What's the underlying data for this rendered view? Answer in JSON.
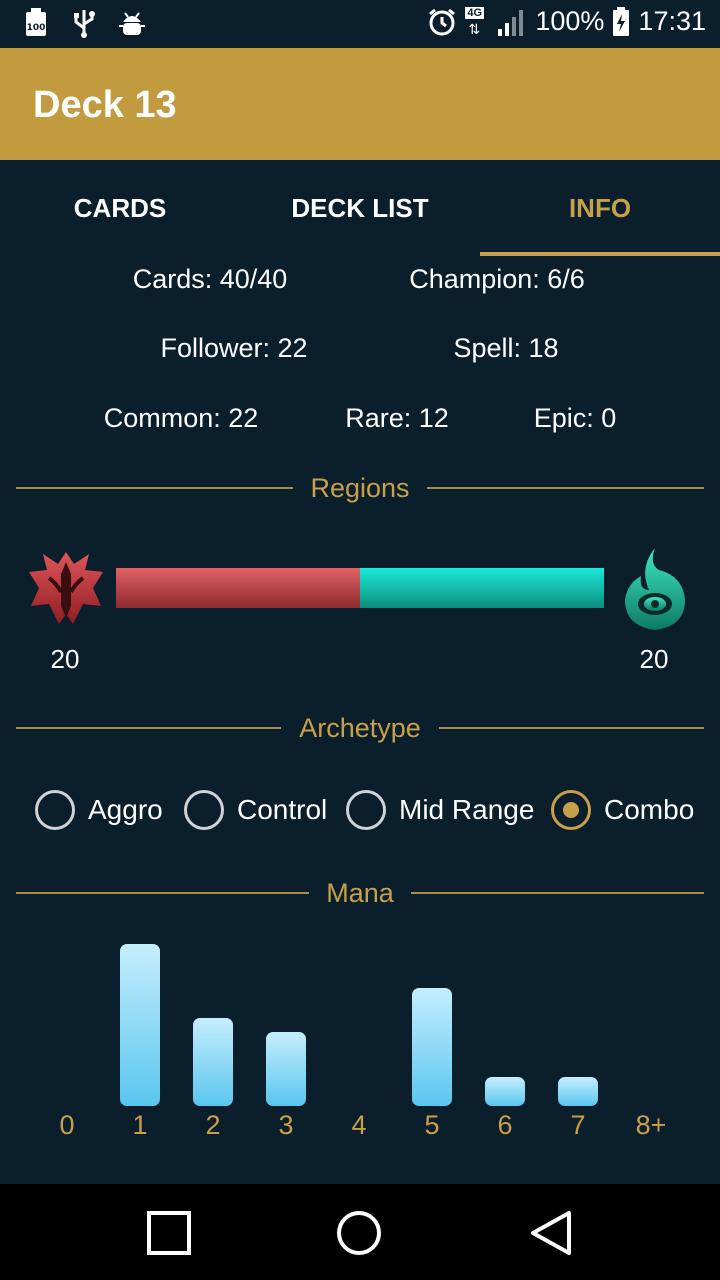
{
  "status_bar": {
    "left_icons": [
      "battery-100-icon",
      "usb-icon",
      "android-debug-icon"
    ],
    "network_badge": "4G",
    "battery": "100%",
    "time": "17:31"
  },
  "app_bar": {
    "title": "Deck 13"
  },
  "tabs": [
    {
      "label": "CARDS",
      "active": false
    },
    {
      "label": "DECK LIST",
      "active": false
    },
    {
      "label": "INFO",
      "active": true
    }
  ],
  "stats": {
    "cards": "Cards: 40/40",
    "champion": "Champion: 6/6",
    "follower": "Follower: 22",
    "spell": "Spell: 18",
    "common": "Common: 22",
    "rare": "Rare: 12",
    "epic": "Epic: 0"
  },
  "regions": {
    "title": "Regions",
    "left": {
      "icon": "noxus-region-icon",
      "count": "20",
      "share": 0.5,
      "color": "#c2444a"
    },
    "right": {
      "icon": "shadow-isles-region-icon",
      "count": "20",
      "share": 0.5,
      "color": "#1cd9c8"
    }
  },
  "archetype": {
    "title": "Archetype",
    "options": [
      {
        "label": "Aggro",
        "checked": false
      },
      {
        "label": "Control",
        "checked": false
      },
      {
        "label": "Mid Range",
        "checked": false
      },
      {
        "label": "Combo",
        "checked": true
      }
    ]
  },
  "mana": {
    "title": "Mana",
    "chart_data": {
      "type": "bar",
      "categories": [
        "0",
        "1",
        "2",
        "3",
        "4",
        "5",
        "6",
        "7",
        "8+"
      ],
      "values": [
        0,
        11,
        6,
        5,
        0,
        8,
        2,
        2,
        0
      ],
      "ylim": [
        0,
        11
      ]
    }
  },
  "nav_bar": {
    "icons": [
      "recents-square-icon",
      "home-circle-icon",
      "back-triangle-icon"
    ]
  },
  "colors": {
    "accent": "#c39b3f",
    "background": "#0b1e2b",
    "mana_bar": "#8fdaf6"
  }
}
